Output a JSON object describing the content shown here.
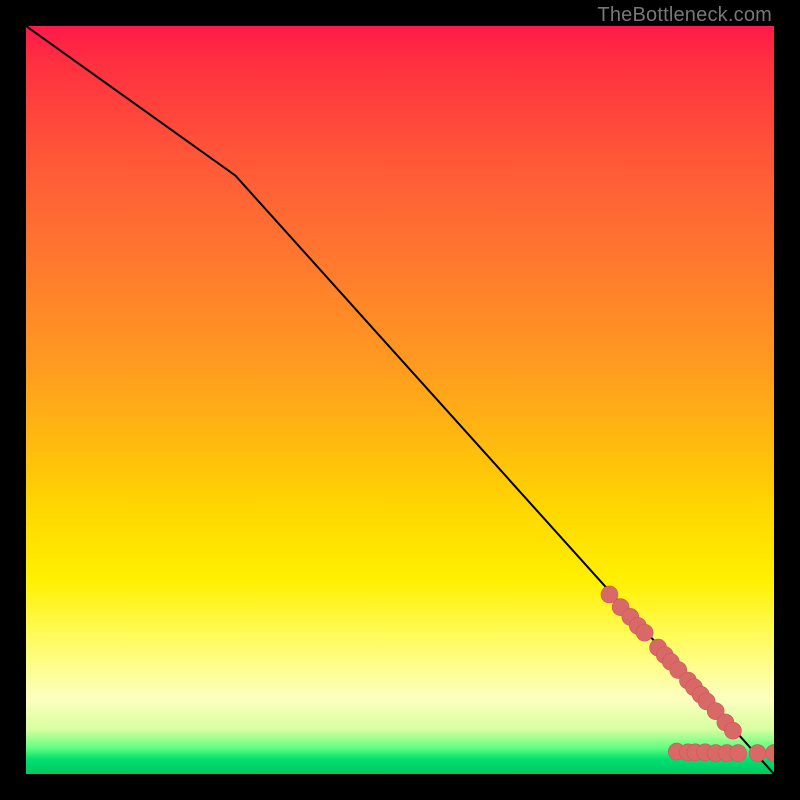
{
  "attribution": "TheBottleneck.com",
  "colors": {
    "top": "#ff1a4a",
    "bottom": "#00c860",
    "marker": "#d96966",
    "curve": "#000000",
    "frame": "#000000"
  },
  "chart_data": {
    "type": "line",
    "title": "",
    "xlabel": "",
    "ylabel": "",
    "xlim": [
      0,
      100
    ],
    "ylim": [
      0,
      100
    ],
    "grid": false,
    "note": "Axes are unlabeled; values are estimated as fractions of plot width/height (0–100 each).",
    "curve": {
      "x": [
        0,
        28,
        100
      ],
      "y": [
        100,
        80,
        0
      ]
    },
    "markers": {
      "name": "highlighted points",
      "points": [
        {
          "x": 78.0,
          "y": 24.0
        },
        {
          "x": 79.5,
          "y": 22.3
        },
        {
          "x": 80.8,
          "y": 21.0
        },
        {
          "x": 81.8,
          "y": 19.8
        },
        {
          "x": 82.7,
          "y": 18.9
        },
        {
          "x": 84.5,
          "y": 16.9
        },
        {
          "x": 85.4,
          "y": 15.9
        },
        {
          "x": 86.2,
          "y": 15.0
        },
        {
          "x": 87.2,
          "y": 13.9
        },
        {
          "x": 88.5,
          "y": 12.5
        },
        {
          "x": 89.3,
          "y": 11.6
        },
        {
          "x": 90.2,
          "y": 10.6
        },
        {
          "x": 91.0,
          "y": 9.7
        },
        {
          "x": 92.2,
          "y": 8.4
        },
        {
          "x": 93.5,
          "y": 6.9
        },
        {
          "x": 94.5,
          "y": 5.8
        },
        {
          "x": 87.0,
          "y": 3.0
        },
        {
          "x": 88.5,
          "y": 2.9
        },
        {
          "x": 89.5,
          "y": 2.9
        },
        {
          "x": 90.8,
          "y": 2.9
        },
        {
          "x": 92.2,
          "y": 2.8
        },
        {
          "x": 93.7,
          "y": 2.8
        },
        {
          "x": 95.2,
          "y": 2.8
        },
        {
          "x": 97.8,
          "y": 2.8
        },
        {
          "x": 100.0,
          "y": 2.8
        }
      ]
    }
  }
}
